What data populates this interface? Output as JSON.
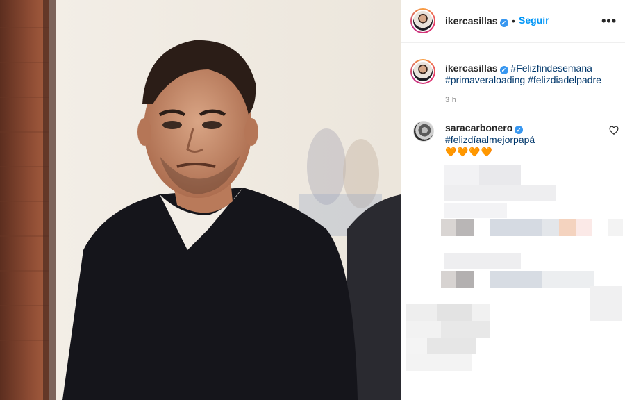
{
  "post": {
    "author": {
      "username": "ikercasillas",
      "follow_label": "Seguir",
      "separator": "•",
      "more_label": "•••"
    },
    "caption": {
      "username": "ikercasillas",
      "hashtags": [
        "#Felizfindesemana",
        "#primaveraloading",
        "#felizdiadelpadre"
      ],
      "timestamp": "3 h"
    },
    "comments": [
      {
        "username": "saracarbonero",
        "text": "#felizdíaalmejorpapá",
        "emoji": "🧡🧡🧡🧡"
      }
    ]
  },
  "icons": {
    "verified": "verified-badge-icon",
    "more": "more-options-icon",
    "like": "heart-outline-icon"
  },
  "colors": {
    "accent": "#0095f6",
    "hashtag": "#00376b",
    "verified": "#3897f0",
    "muted": "#8e8e8e"
  }
}
